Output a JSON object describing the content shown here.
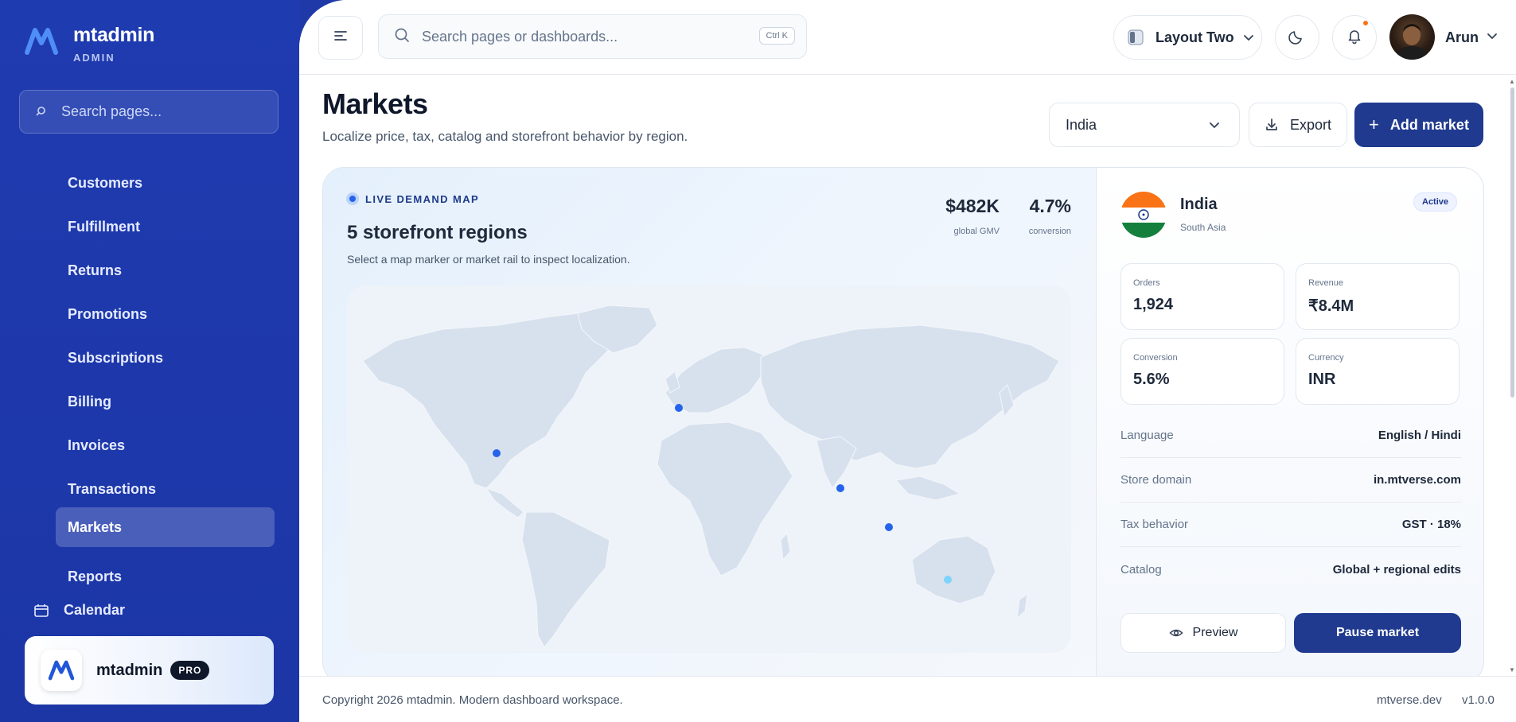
{
  "brand": {
    "name": "mtadmin",
    "sub": "ADMIN",
    "accent": "#1f3bb0"
  },
  "sidebar": {
    "search_placeholder": "Search pages...",
    "items": [
      {
        "label": "Customers",
        "active": false
      },
      {
        "label": "Fulfillment",
        "active": false
      },
      {
        "label": "Returns",
        "active": false
      },
      {
        "label": "Promotions",
        "active": false
      },
      {
        "label": "Subscriptions",
        "active": false
      },
      {
        "label": "Billing",
        "active": false
      },
      {
        "label": "Invoices",
        "active": false
      },
      {
        "label": "Transactions",
        "active": false
      },
      {
        "label": "Markets",
        "active": true
      },
      {
        "label": "Reports",
        "active": false
      }
    ],
    "calendar_label": "Calendar",
    "calendar_icon": "calendar-icon",
    "promo": {
      "name": "mtadmin",
      "badge": "PRO"
    }
  },
  "topbar": {
    "search_placeholder": "Search pages or dashboards...",
    "shortcut": "Ctrl K",
    "layout_label": "Layout Two",
    "user_name": "Arun",
    "notification_color": "#f97316"
  },
  "page": {
    "title": "Markets",
    "subtitle": "Localize price, tax, catalog and storefront behavior by region.",
    "region_select": "India",
    "export_label": "Export",
    "add_label": "Add market"
  },
  "map": {
    "tag": "LIVE DEMAND MAP",
    "heading": "5 storefront regions",
    "hint": "Select a map marker or market rail to inspect localization.",
    "stats": [
      {
        "value": "$482K",
        "label": "global GMV"
      },
      {
        "value": "4.7%",
        "label": "conversion"
      }
    ],
    "markers": [
      "United States",
      "United Kingdom",
      "India",
      "Singapore",
      "Australia"
    ],
    "marker_color": "#2563eb"
  },
  "detail": {
    "country": "India",
    "region": "South Asia",
    "status": "Active",
    "metrics": [
      {
        "label": "Orders",
        "value": "1,924"
      },
      {
        "label": "Revenue",
        "value": "₹8.4M"
      },
      {
        "label": "Conversion",
        "value": "5.6%"
      },
      {
        "label": "Currency",
        "value": "INR"
      }
    ],
    "rows": [
      {
        "key": "Language",
        "value": "English / Hindi"
      },
      {
        "key": "Store domain",
        "value": "in.mtverse.com"
      },
      {
        "key": "Tax behavior",
        "value": "GST · 18%"
      },
      {
        "key": "Catalog",
        "value": "Global + regional edits"
      }
    ],
    "preview_label": "Preview",
    "pause_label": "Pause market"
  },
  "footer": {
    "copyright": "Copyright 2026 mtadmin. Modern dashboard workspace.",
    "site": "mtverse.dev",
    "version": "v1.0.0"
  }
}
